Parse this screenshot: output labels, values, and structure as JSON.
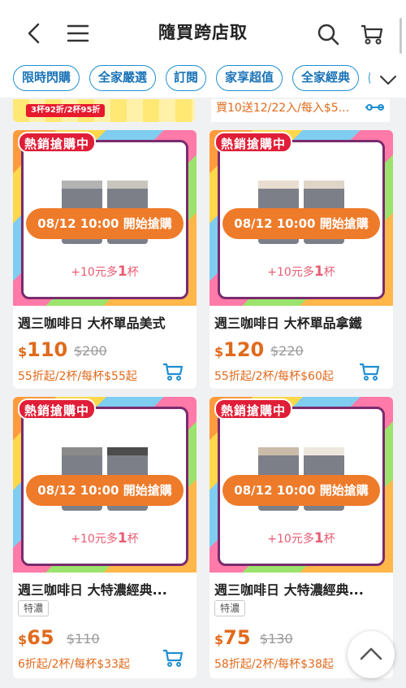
{
  "header": {
    "title": "隨買跨店取",
    "icons": {
      "back": "chevron-left-icon",
      "menu": "hamburger-menu-icon",
      "search": "search-icon",
      "cart": "cart-icon"
    }
  },
  "tabs": [
    {
      "label": "限時閃購"
    },
    {
      "label": "全家嚴選"
    },
    {
      "label": "訂閱"
    },
    {
      "label": "家享超值"
    },
    {
      "label": "全家經典"
    }
  ],
  "tabs_more_icon": "chevron-down-icon",
  "partial_row": {
    "left_badge": "3杯92折/2杯95折",
    "right_text": "買10送12/22入/每入$5..."
  },
  "colors": {
    "accent": "#e06a1c",
    "brand_blue": "#1f8fd1",
    "hot_red": "#e01e37",
    "cta_orange": "#ee7b2a"
  },
  "products": [
    {
      "hot": "熱銷搶購中",
      "cta": "08/12 10:00 開始搶購",
      "promo_pre": "+10元多",
      "promo_num": "1",
      "promo_post": "杯",
      "name": "週三咖啡日 大杯單品美式",
      "tag": "",
      "currency": "$",
      "price": "110",
      "old_price": "$200",
      "deal": "55折起/2杯/每杯$55起"
    },
    {
      "hot": "熱銷搶購中",
      "cta": "08/12 10:00 開始搶購",
      "promo_pre": "+10元多",
      "promo_num": "1",
      "promo_post": "杯",
      "name": "週三咖啡日 大杯單品拿鐵",
      "tag": "",
      "currency": "$",
      "price": "120",
      "old_price": "$220",
      "deal": "55折起/2杯/每杯$60起"
    },
    {
      "hot": "熱銷搶購中",
      "cta": "08/12 10:00 開始搶購",
      "promo_pre": "+10元多",
      "promo_num": "1",
      "promo_post": "杯",
      "name": "週三咖啡日 大特濃經典...",
      "tag": "特濃",
      "currency": "$",
      "price": "65",
      "old_price": "$110",
      "deal": "6折起/2杯/每杯$33起"
    },
    {
      "hot": "熱銷搶購中",
      "cta": "08/12 10:00 開始搶購",
      "promo_pre": "+10元多",
      "promo_num": "1",
      "promo_post": "杯",
      "name": "週三咖啡日 大特濃經典...",
      "tag": "特濃",
      "currency": "$",
      "price": "75",
      "old_price": "$130",
      "deal": "58折起/2杯/每杯$38起"
    }
  ],
  "scroll_top_icon": "chevron-up-icon"
}
